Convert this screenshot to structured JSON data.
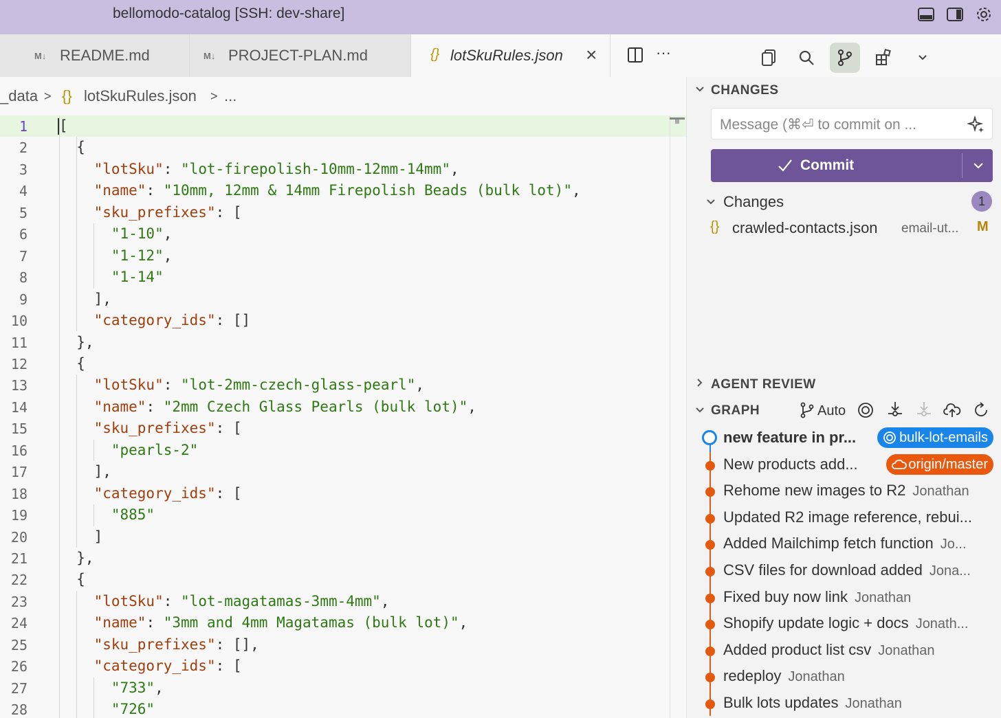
{
  "window": {
    "title": "bellomodo-catalog [SSH: dev-share]"
  },
  "tabs": [
    {
      "label": "README.md",
      "glyph": "M↓"
    },
    {
      "label": "PROJECT-PLAN.md",
      "glyph": "M↓"
    },
    {
      "label": "lotSkuRules.json",
      "glyph": "{}",
      "close": "×"
    }
  ],
  "breadcrumb": {
    "folder": "_data",
    "sep1": ">",
    "icon": "{}",
    "file": "lotSkuRules.json",
    "sep2": ">",
    "more": "..."
  },
  "editor": {
    "line_numbers": [
      "1",
      "2",
      "3",
      "4",
      "5",
      "6",
      "7",
      "8",
      "9",
      "10",
      "11",
      "12",
      "13",
      "14",
      "15",
      "16",
      "17",
      "18",
      "19",
      "20",
      "21",
      "22",
      "23",
      "24",
      "25",
      "26",
      "27",
      "28"
    ],
    "current_line": 1
  },
  "scm": {
    "changes_title": "CHANGES",
    "message_placeholder": "Message (⌘⏎ to commit on ...",
    "commit_label": "Commit",
    "changes_group_label": "Changes",
    "changes_count": "1",
    "file": {
      "name": "crawled-contacts.json",
      "path": "email-ut...",
      "status": "M",
      "icon": "{}"
    },
    "agent_review_title": "AGENT REVIEW",
    "graph_title": "GRAPH",
    "graph_auto_label": "Auto"
  },
  "graph": {
    "commits": [
      {
        "message": "new feature in pr...",
        "author": "",
        "ref": "bulk-lot-emails",
        "ref_color": "#1a85e8",
        "head": true
      },
      {
        "message": "New products add...",
        "author": "",
        "ref": "origin/master",
        "ref_color": "#e9580c"
      },
      {
        "message": "Rehome new images to R2",
        "author": "Jonathan"
      },
      {
        "message": "Updated R2 image reference, rebui...",
        "author": ""
      },
      {
        "message": "Added Mailchimp fetch function",
        "author": "Jo..."
      },
      {
        "message": "CSV files for download added",
        "author": "Jona..."
      },
      {
        "message": "Fixed buy now link",
        "author": "Jonathan"
      },
      {
        "message": "Shopify update logic + docs",
        "author": "Jonath..."
      },
      {
        "message": "Added product list csv",
        "author": "Jonathan"
      },
      {
        "message": "redeploy",
        "author": "Jonathan"
      },
      {
        "message": "Bulk lots updates",
        "author": "Jonathan"
      }
    ]
  },
  "code_lines": [
    [
      [
        "p",
        "["
      ]
    ],
    [
      [
        "p",
        "  {"
      ]
    ],
    [
      [
        "p",
        "    "
      ],
      [
        "k",
        "\"lotSku\""
      ],
      [
        "p",
        ": "
      ],
      [
        "s",
        "\"lot-firepolish-10mm-12mm-14mm\""
      ],
      [
        "p",
        ","
      ]
    ],
    [
      [
        "p",
        "    "
      ],
      [
        "k",
        "\"name\""
      ],
      [
        "p",
        ": "
      ],
      [
        "s",
        "\"10mm, 12mm & 14mm Firepolish Beads (bulk lot)\""
      ],
      [
        "p",
        ","
      ]
    ],
    [
      [
        "p",
        "    "
      ],
      [
        "k",
        "\"sku_prefixes\""
      ],
      [
        "p",
        ": ["
      ]
    ],
    [
      [
        "p",
        "      "
      ],
      [
        "s",
        "\"1-10\""
      ],
      [
        "p",
        ","
      ]
    ],
    [
      [
        "p",
        "      "
      ],
      [
        "s",
        "\"1-12\""
      ],
      [
        "p",
        ","
      ]
    ],
    [
      [
        "p",
        "      "
      ],
      [
        "s",
        "\"1-14\""
      ]
    ],
    [
      [
        "p",
        "    ],"
      ]
    ],
    [
      [
        "p",
        "    "
      ],
      [
        "k",
        "\"category_ids\""
      ],
      [
        "p",
        ": []"
      ]
    ],
    [
      [
        "p",
        "  },"
      ]
    ],
    [
      [
        "p",
        "  {"
      ]
    ],
    [
      [
        "p",
        "    "
      ],
      [
        "k",
        "\"lotSku\""
      ],
      [
        "p",
        ": "
      ],
      [
        "s",
        "\"lot-2mm-czech-glass-pearl\""
      ],
      [
        "p",
        ","
      ]
    ],
    [
      [
        "p",
        "    "
      ],
      [
        "k",
        "\"name\""
      ],
      [
        "p",
        ": "
      ],
      [
        "s",
        "\"2mm Czech Glass Pearls (bulk lot)\""
      ],
      [
        "p",
        ","
      ]
    ],
    [
      [
        "p",
        "    "
      ],
      [
        "k",
        "\"sku_prefixes\""
      ],
      [
        "p",
        ": ["
      ]
    ],
    [
      [
        "p",
        "      "
      ],
      [
        "s",
        "\"pearls-2\""
      ]
    ],
    [
      [
        "p",
        "    ],"
      ]
    ],
    [
      [
        "p",
        "    "
      ],
      [
        "k",
        "\"category_ids\""
      ],
      [
        "p",
        ": ["
      ]
    ],
    [
      [
        "p",
        "      "
      ],
      [
        "s",
        "\"885\""
      ]
    ],
    [
      [
        "p",
        "    ]"
      ]
    ],
    [
      [
        "p",
        "  },"
      ]
    ],
    [
      [
        "p",
        "  {"
      ]
    ],
    [
      [
        "p",
        "    "
      ],
      [
        "k",
        "\"lotSku\""
      ],
      [
        "p",
        ": "
      ],
      [
        "s",
        "\"lot-magatamas-3mm-4mm\""
      ],
      [
        "p",
        ","
      ]
    ],
    [
      [
        "p",
        "    "
      ],
      [
        "k",
        "\"name\""
      ],
      [
        "p",
        ": "
      ],
      [
        "s",
        "\"3mm and 4mm Magatamas (bulk lot)\""
      ],
      [
        "p",
        ","
      ]
    ],
    [
      [
        "p",
        "    "
      ],
      [
        "k",
        "\"sku_prefixes\""
      ],
      [
        "p",
        ": [],"
      ]
    ],
    [
      [
        "p",
        "    "
      ],
      [
        "k",
        "\"category_ids\""
      ],
      [
        "p",
        ": ["
      ]
    ],
    [
      [
        "p",
        "      "
      ],
      [
        "s",
        "\"733\""
      ],
      [
        "p",
        ","
      ]
    ],
    [
      [
        "p",
        "      "
      ],
      [
        "s",
        "\"726\""
      ]
    ]
  ]
}
